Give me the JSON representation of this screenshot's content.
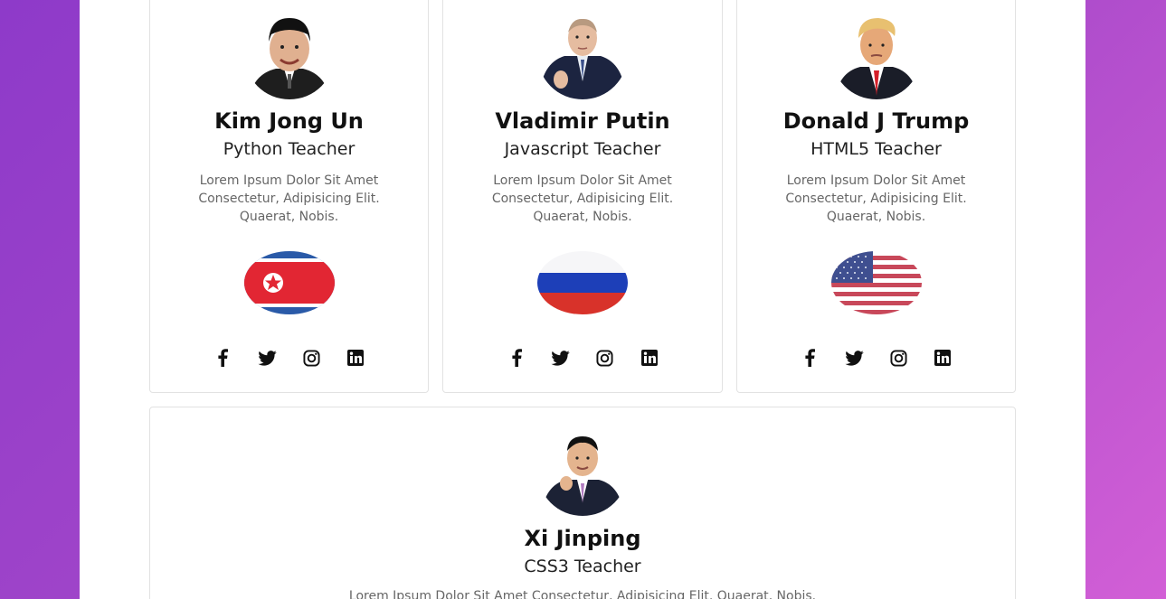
{
  "teachers": [
    {
      "name": "Kim Jong Un",
      "role": "Python Teacher",
      "description": "Lorem Ipsum Dolor Sit Amet Consectetur, Adipisicing Elit. Quaerat, Nobis.",
      "flag": "north-korea-flag",
      "socials": [
        "facebook-icon",
        "twitter-icon",
        "instagram-icon",
        "linkedin-icon"
      ]
    },
    {
      "name": "Vladimir Putin",
      "role": "Javascript Teacher",
      "description": "Lorem Ipsum Dolor Sit Amet Consectetur, Adipisicing Elit. Quaerat, Nobis.",
      "flag": "russia-flag",
      "socials": [
        "facebook-icon",
        "twitter-icon",
        "instagram-icon",
        "linkedin-icon"
      ]
    },
    {
      "name": "Donald J Trump",
      "role": "HTML5 Teacher",
      "description": "Lorem Ipsum Dolor Sit Amet Consectetur, Adipisicing Elit. Quaerat, Nobis.",
      "flag": "usa-flag",
      "socials": [
        "facebook-icon",
        "twitter-icon",
        "instagram-icon",
        "linkedin-icon"
      ]
    },
    {
      "name": "Xi Jinping",
      "role": "CSS3 Teacher",
      "description": "Lorem Ipsum Dolor Sit Amet Consectetur, Adipisicing Elit. Quaerat, Nobis."
    }
  ],
  "colors": {
    "background_start": "#8e3ac9",
    "background_end": "#d25fd6",
    "card_border": "#e2e2e2",
    "text_dark": "#111111",
    "text_muted": "#666666"
  }
}
